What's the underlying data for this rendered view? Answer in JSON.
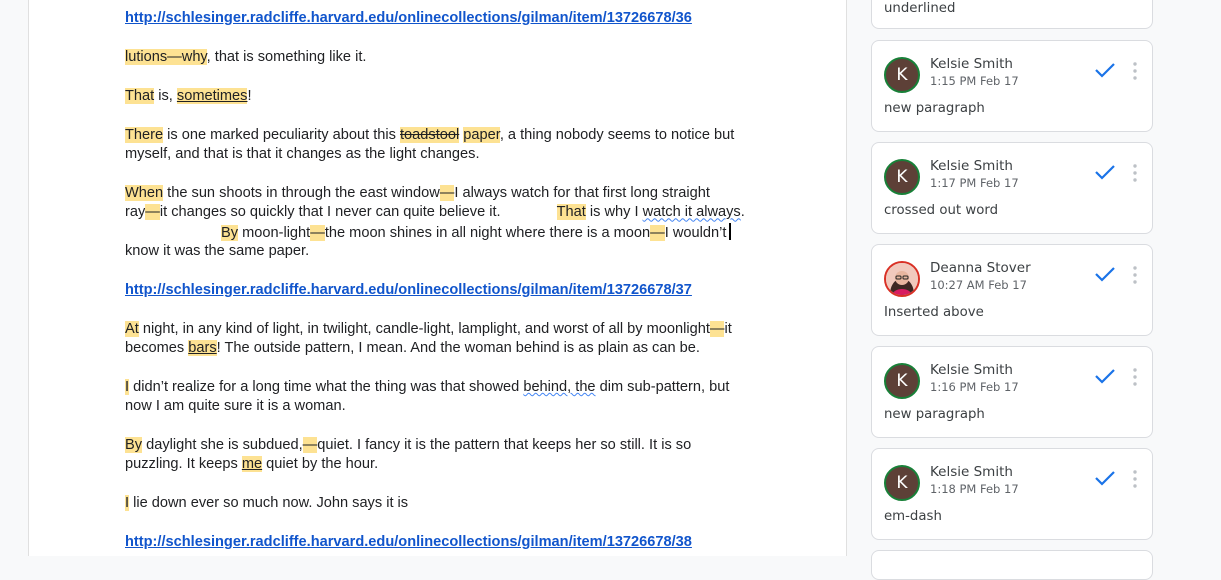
{
  "document": {
    "link_36": "http://schlesinger.radcliffe.harvard.edu/onlinecollections/gilman/item/13726678/36",
    "link_37": "http://schlesinger.radcliffe.harvard.edu/onlinecollections/gilman/item/13726678/37",
    "link_38": "http://schlesinger.radcliffe.harvard.edu/onlinecollections/gilman/item/13726678/38",
    "p1": {
      "hl": "lutions—why",
      "rest": ", that is something like it."
    },
    "p2": {
      "hl1": "That",
      "mid": " is, ",
      "hl2": "sometimes",
      "end": "!"
    },
    "p3": {
      "hl1": "There",
      "t1": " is one marked peculiarity about this ",
      "strike": "toadstool",
      "t2": " ",
      "hl2": "paper",
      "t3": ", a thing nobody seems to notice but",
      "line2": "myself, and that is that it changes as the light changes."
    },
    "p4": {
      "hl1": "When",
      "t1": " the sun shoots in through the east window",
      "hl2": "—",
      "t2": "I always watch for that first long straight",
      "t3": "ray",
      "hl3": "—",
      "t4": "it changes so quickly that I never can quite believe it.",
      "hl4": "That",
      "t5": " is why I ",
      "sq1": "watch it always",
      "t6": ".",
      "hl5": "By",
      "t7": " moon-light",
      "hl6": "—",
      "t8": "the moon shines in all night where there is a moon",
      "hl7": "—",
      "t9": "I wouldn’t",
      "line4": "know it was the same paper."
    },
    "p5": {
      "hl1": "At",
      "t1": " night, in any kind of light, in twilight, candle-light, lamplight, and worst of all by moonlight",
      "hl2": "—",
      "t2": "it",
      "t3": "becomes ",
      "hl3": "bars",
      "t4": "! The outside pattern, I mean. And the woman behind is as plain as can be."
    },
    "p6": {
      "hl1": "I",
      "t1": " didn’t realize for a long time what the thing was that showed ",
      "sq1": "behind, the",
      "t2": " dim sub-pattern, but",
      "line2": "now I am quite sure it is a woman."
    },
    "p7": {
      "hl1": "By",
      "t1": " daylight she is subdued,",
      "hl2": "—",
      "t2": "quiet. I fancy it is the pattern that keeps her so still. It is so",
      "t3": "puzzling. It keeps ",
      "hl3": "me",
      "t4": " quiet by the hour."
    },
    "p8": {
      "hl1": "I",
      "t1": " lie down ever so much now. John says it is"
    }
  },
  "comments": {
    "top_partial_text": "underlined",
    "items": [
      {
        "author": "Kelsie Smith",
        "initial": "K",
        "time": "1:15 PM Feb 17",
        "text": "new paragraph"
      },
      {
        "author": "Kelsie Smith",
        "initial": "K",
        "time": "1:17 PM Feb 17",
        "text": "crossed out word"
      },
      {
        "author": "Deanna Stover",
        "initial": "",
        "time": "10:27 AM Feb 17",
        "text": "Inserted above"
      },
      {
        "author": "Kelsie Smith",
        "initial": "K",
        "time": "1:16 PM Feb 17",
        "text": "new paragraph"
      },
      {
        "author": "Kelsie Smith",
        "initial": "K",
        "time": "1:18 PM Feb 17",
        "text": "em-dash"
      }
    ]
  },
  "colors": {
    "highlight": "#fde293",
    "link": "#1155cc",
    "resolve_check": "#1a73e8",
    "avatar_ring": "#188038"
  },
  "icons": [
    "resolve-check-icon",
    "more-vert-icon",
    "avatar-photo"
  ]
}
